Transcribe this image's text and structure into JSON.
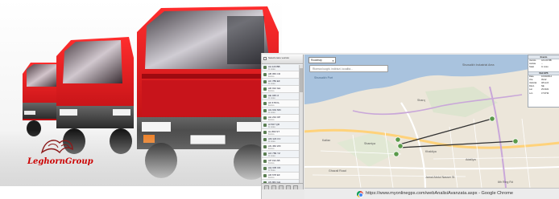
{
  "brand": {
    "name": "LeghornGroup"
  },
  "app": {
    "sidebar": {
      "header": "Selezionare veicolo",
      "items": [
        {
          "name": "AA 123 BB",
          "status": "In moto"
        },
        {
          "name": "AB 456 CD",
          "status": "Fermo"
        },
        {
          "name": "AC 789 EF",
          "status": "In moto"
        },
        {
          "name": "AD 012 GH",
          "status": "Fermo"
        },
        {
          "name": "AE 345 IJ",
          "status": "In moto"
        },
        {
          "name": "AF 678 KL",
          "status": "Fermo"
        },
        {
          "name": "AG 901 MN",
          "status": "In moto"
        },
        {
          "name": "AH 234 OP",
          "status": "Fermo"
        },
        {
          "name": "AI 567 QR",
          "status": "In moto"
        },
        {
          "name": "AL 890 ST",
          "status": "Fermo"
        },
        {
          "name": "AM 123 UV",
          "status": "In moto"
        },
        {
          "name": "AN 456 WX",
          "status": "Fermo"
        },
        {
          "name": "AO 789 YZ",
          "status": "In moto"
        },
        {
          "name": "AP 012 AB",
          "status": "Fermo"
        },
        {
          "name": "AQ 345 CD",
          "status": "In moto"
        },
        {
          "name": "AR 678 EF",
          "status": "Fermo"
        },
        {
          "name": "AS 901 GH",
          "status": "In moto"
        }
      ]
    },
    "map": {
      "type_select": "Roadmap",
      "search_placeholder": "Ricerca luoghi, indirizzi, località...",
      "labels": {
        "bay_name": "Shuwaikh Port",
        "area_1": "Shuwaikh Industrial Area",
        "area_2": "Sharq",
        "area_3": "Kaifan",
        "area_4": "Shamiya",
        "area_5": "Khaldiya",
        "area_6": "Adailiya",
        "road_1": "Ghazali Road",
        "road_2": "Jamal Abdul Nasser St",
        "road_3": "6th Ring Rd"
      },
      "info_panel": {
        "title": "Evento",
        "rows": [
          {
            "k": "Veicolo",
            "v": "AA 123 BB"
          },
          {
            "k": "Autista",
            "v": "--"
          },
          {
            "k": "Stato",
            "v": "In moto"
          }
        ],
        "section": "Dati GPS",
        "rows2": [
          {
            "k": "Data",
            "v": "10/10/2014"
          },
          {
            "k": "Ora",
            "v": "09:42"
          },
          {
            "k": "Velocità",
            "v": "48 km/h"
          },
          {
            "k": "Direz.",
            "v": "NE"
          },
          {
            "k": "Lat",
            "v": "29.3421"
          },
          {
            "k": "Lon",
            "v": "47.9734"
          }
        ]
      }
    },
    "status_bar": {
      "url": "https://www.myonlinegps.com/webAnalisiAvanzata.aspx - Google Chrome",
      "browser_icon": "chrome-icon"
    }
  },
  "colors": {
    "truck_red": "#d71920",
    "sea": "#a9c3de",
    "land": "#ece6da",
    "road_major": "#ffd27a",
    "route_line": "#333333",
    "marker": "#5a9a4a"
  }
}
